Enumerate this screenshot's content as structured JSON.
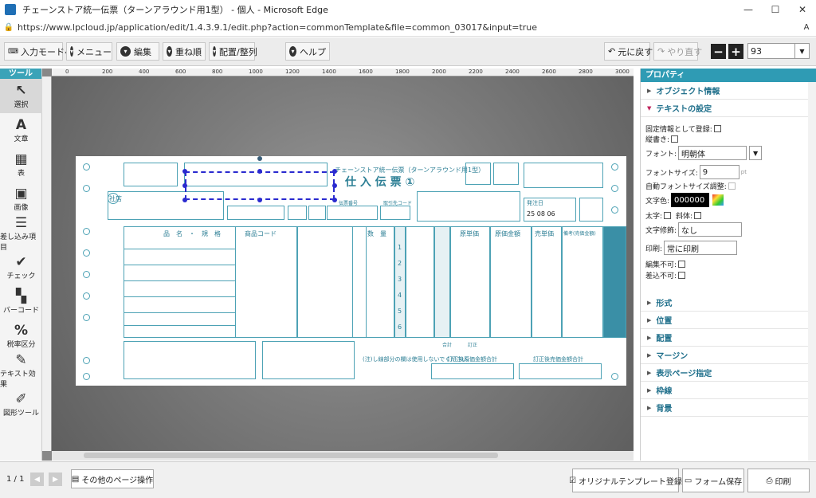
{
  "browser": {
    "title": "チェーンストア統一伝票（ターンアラウンド用1型） - 個人 - Microsoft Edge",
    "url": "https://www.lpcloud.jp/application/edit/1.4.3.9.1/edit.php?action=commonTemplate&file=common_03017&input=true",
    "min": "—",
    "max": "☐",
    "close": "✕"
  },
  "toolbar": {
    "input_mode": "入力モードへ",
    "menu": "メニュー",
    "edit": "編集",
    "order": "重ね順",
    "arrange": "配置/整列",
    "help": "ヘルプ",
    "undo": "元に戻す",
    "redo": "やり直す",
    "zoom_out": "−",
    "zoom_in": "+",
    "zoom": "93"
  },
  "tools": {
    "header": "ツール",
    "items": [
      {
        "label": "選択",
        "icon": "↖"
      },
      {
        "label": "文章",
        "icon": "A"
      },
      {
        "label": "表",
        "icon": "▦"
      },
      {
        "label": "画像",
        "icon": "▣"
      },
      {
        "label": "差し込み項目",
        "icon": "☰"
      },
      {
        "label": "チェック",
        "icon": "✔"
      },
      {
        "label": "バーコード",
        "icon": "▚"
      },
      {
        "label": "税率区分",
        "icon": "%"
      },
      {
        "label": "テキスト効果",
        "icon": "✎"
      },
      {
        "label": "図形ツール",
        "icon": "✐"
      }
    ]
  },
  "ruler": {
    "ticks": [
      "0",
      "200",
      "400",
      "600",
      "800",
      "1000",
      "1200",
      "1400",
      "1600",
      "1800",
      "2000",
      "2200",
      "2400",
      "2600",
      "2800",
      "3000"
    ]
  },
  "form": {
    "title_small": "チェーンストア統一伝票（ターンアラウンド用1型）",
    "title_big": "仕 入 伝 票 ①",
    "col_item": "品　名　・　規　格",
    "col_code": "商品コード",
    "col_qty": "数　量",
    "col_cost_unit": "原単価",
    "col_cost_amount": "原価金額",
    "col_sell_unit": "売単価",
    "col_tax": "備考(売価金額)",
    "row_numbers": [
      "1",
      "2",
      "3",
      "4",
      "5",
      "6"
    ],
    "delivery_date": "25 08 06",
    "note": "(注)し線部分の欄は使用しないでください。",
    "total_cost": "訂正後原価金額合計",
    "total_sell": "訂正後売価金額合計",
    "total_label": "合計",
    "corrected_label": "訂正",
    "arrival_label": "発注日",
    "shop_label": "社店",
    "section_label": "伝票番号",
    "torihiki_label": "取引先コード"
  },
  "props": {
    "header": "プロパティ",
    "object_info": "オブジェクト情報",
    "text_settings": "テキストの設定",
    "fixed_info": "固定情報として登録:",
    "vertical": "縦書き:",
    "font_label": "フォント:",
    "font_value": "明朝体",
    "font_size_label": "フォントサイズ:",
    "font_size_value": "9",
    "font_size_unit": "pt",
    "auto_font": "自動フォントサイズ調整:",
    "color_label": "文字色:",
    "color_value": "000000",
    "bold": "太字:",
    "italic": "斜体:",
    "decoration_label": "文字修飾:",
    "decoration_value": "なし",
    "print_label": "印刷:",
    "print_value": "常に印刷",
    "no_edit": "編集不可:",
    "no_insert": "差込不可:",
    "sections": [
      "形式",
      "位置",
      "配置",
      "マージン",
      "表示ページ指定",
      "枠線",
      "背景"
    ]
  },
  "bottom": {
    "page": "1 / 1",
    "other_ops": "その他のページ操作",
    "original_register": "オリジナルテンプレート登録",
    "save": "フォーム保存",
    "print": "印刷"
  },
  "colors": {
    "accent": "#2f9bb4",
    "selection": "#2a2acf",
    "form_line": "#4da2b5"
  }
}
